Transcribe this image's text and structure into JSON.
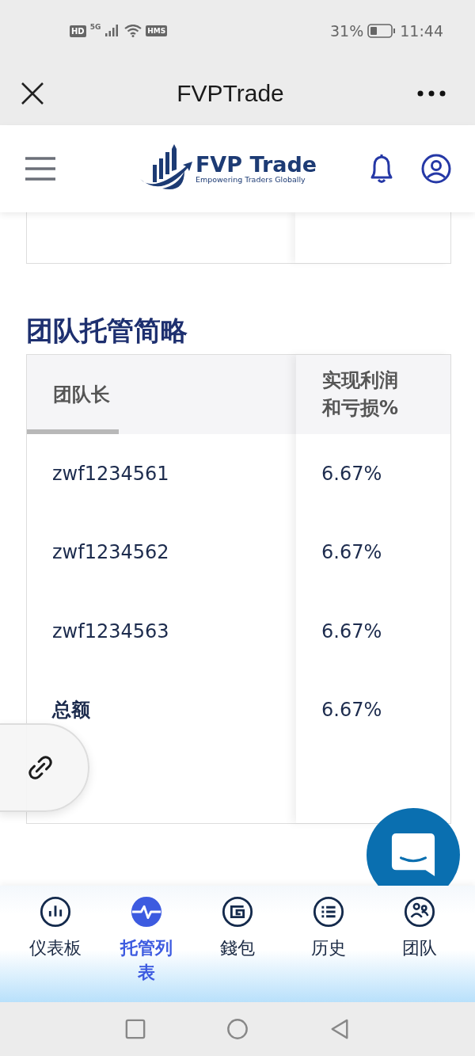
{
  "status_bar": {
    "network_labels": [
      "HD",
      "5G",
      "HMS"
    ],
    "battery": "31%",
    "time": "11:44"
  },
  "window": {
    "title": "FVPTrade"
  },
  "header": {
    "logo_title": "FVP Trade",
    "logo_tagline": "Empowering Traders Globally"
  },
  "section": {
    "title": "团队托管简略"
  },
  "table": {
    "columns": [
      {
        "label": "团队长",
        "selected": true
      },
      {
        "label": "实现利润和亏损%",
        "selected": false
      }
    ],
    "rows": [
      {
        "kind": "member",
        "leader": "zwf1234561",
        "pnl": "6.67%"
      },
      {
        "kind": "member",
        "leader": "zwf1234562",
        "pnl": "6.67%"
      },
      {
        "kind": "member",
        "leader": "zwf1234563",
        "pnl": "6.67%"
      },
      {
        "kind": "total",
        "leader": "总额",
        "pnl": "6.67%"
      }
    ]
  },
  "bottom_nav": [
    {
      "kind": "chart",
      "label": "仪表板",
      "selected": false
    },
    {
      "kind": "pulse",
      "label": "托管列表",
      "selected": true
    },
    {
      "kind": "wallet",
      "label": "錢包",
      "selected": false
    },
    {
      "kind": "list",
      "label": "历史",
      "selected": false
    },
    {
      "kind": "team",
      "label": "团队",
      "selected": false
    }
  ]
}
